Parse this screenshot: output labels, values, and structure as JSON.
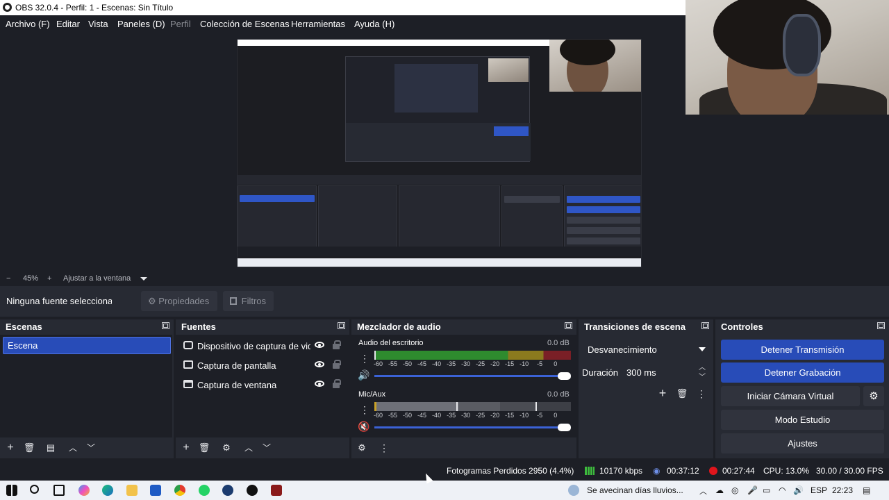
{
  "window": {
    "title": "OBS 32.0.4 - Perfil: 1 - Escenas: Sin Título"
  },
  "menu": {
    "items": [
      "Archivo (F)",
      "Editar",
      "Vista",
      "Paneles (D)",
      "Perfil",
      "Colección de Escenas",
      "Herramientas",
      "Ayuda (H)"
    ]
  },
  "zoom": {
    "minus": "−",
    "value": "45%",
    "plus": "+",
    "fit_label": "Ajustar a la ventana"
  },
  "source_toolbar": {
    "no_source": "Ninguna fuente seleccionada",
    "properties": "Propiedades",
    "filters": "Filtros"
  },
  "scenes": {
    "title": "Escenas",
    "items": [
      "Escena"
    ]
  },
  "sources": {
    "title": "Fuentes",
    "items": [
      "Dispositivo de captura de video",
      "Captura de pantalla",
      "Captura de ventana"
    ]
  },
  "mixer": {
    "title": "Mezclador de audio",
    "channels": [
      {
        "name": "Audio del escritorio",
        "db": "0.0 dB",
        "muted": false
      },
      {
        "name": "Mic/Aux",
        "db": "0.0 dB",
        "muted": true
      }
    ],
    "scale": [
      "-60",
      "-55",
      "-50",
      "-45",
      "-40",
      "-35",
      "-30",
      "-25",
      "-20",
      "-15",
      "-10",
      "-5",
      "0"
    ]
  },
  "transitions": {
    "title": "Transiciones de escena",
    "selected": "Desvanecimiento",
    "duration_label": "Duración",
    "duration_value": "300 ms"
  },
  "controls": {
    "title": "Controles",
    "stop_stream": "Detener Transmisión",
    "stop_record": "Detener Grabación",
    "virtual_cam": "Iniciar Cámara Virtual",
    "studio_mode": "Modo Estudio",
    "settings": "Ajustes"
  },
  "status": {
    "dropped": "Fotogramas Perdidos 2950 (4.4%)",
    "bitrate": "10170 kbps",
    "stream_time": "00:37:12",
    "rec_time": "00:27:44",
    "cpu": "CPU: 13.0%",
    "fps": "30.00 / 30.00 FPS"
  },
  "taskbar": {
    "weather": "Se avecinan días lluvios...",
    "lang": "ESP",
    "time": "22:23"
  },
  "colors": {
    "accent": "#284cb8",
    "panel": "#272a33",
    "background": "#1d1f26",
    "record": "#e0151c"
  }
}
